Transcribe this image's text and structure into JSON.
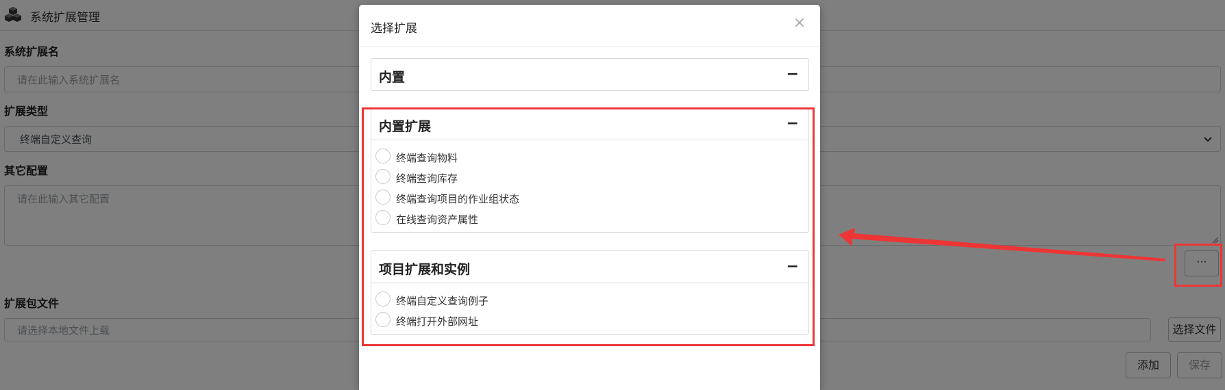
{
  "page": {
    "title": "系统扩展管理",
    "fields": {
      "name_label": "系统扩展名",
      "name_placeholder": "请在此输入系统扩展名",
      "type_label": "扩展类型",
      "type_value": "终端自定义查询",
      "other_label": "其它配置",
      "other_placeholder": "请在此输入其它配置",
      "ellipsis_label": "···",
      "package_label": "扩展包文件",
      "package_placeholder": "请选择本地文件上载"
    },
    "buttons": {
      "choose_file": "选择文件",
      "add": "添加",
      "save": "保存"
    }
  },
  "modal": {
    "title": "选择扩展",
    "close": "×",
    "groups": [
      {
        "title": "内置",
        "toggle": "−",
        "options": []
      },
      {
        "title": "内置扩展",
        "toggle": "−",
        "options": [
          "终端查询物料",
          "终端查询库存",
          "终端查询项目的作业组状态",
          "在线查询资产属性"
        ]
      },
      {
        "title": "项目扩展和实例",
        "toggle": "−",
        "options": [
          "终端自定义查询例子",
          "终端打开外部网址"
        ]
      }
    ]
  },
  "annotation_color": "#ee3535"
}
